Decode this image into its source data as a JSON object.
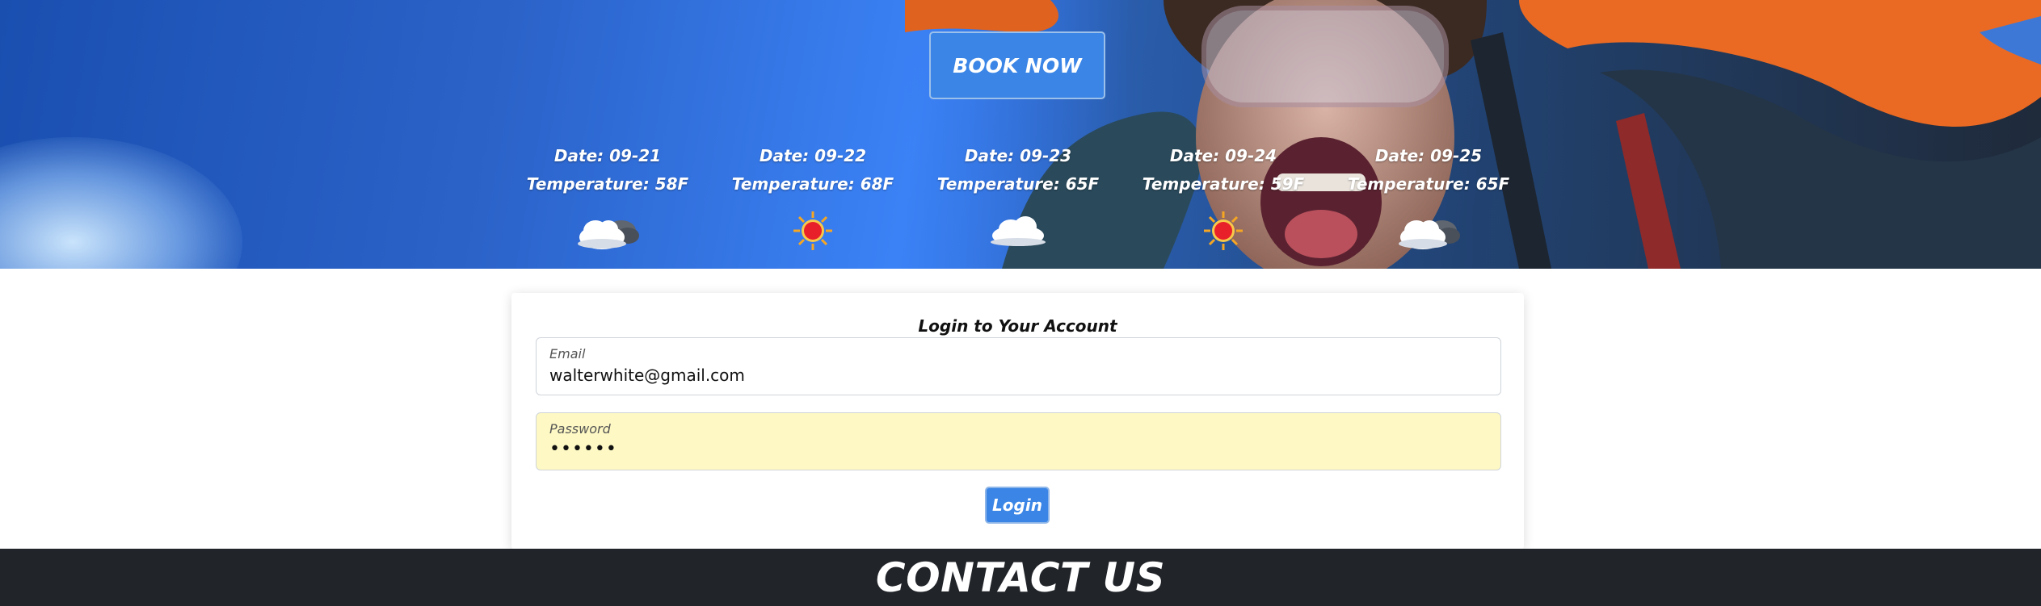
{
  "hero": {
    "book_now_label": "BOOK NOW",
    "forecast": [
      {
        "date": "Date: 09-21",
        "temperature": "Temperature: 58F",
        "icon": "partly-cloudy-icon"
      },
      {
        "date": "Date: 09-22",
        "temperature": "Temperature: 68F",
        "icon": "sun-icon"
      },
      {
        "date": "Date: 09-23",
        "temperature": "Temperature: 65F",
        "icon": "cloud-icon"
      },
      {
        "date": "Date: 09-24",
        "temperature": "Temperature: 59F",
        "icon": "sun-icon"
      },
      {
        "date": "Date: 09-25",
        "temperature": "Temperature: 65F",
        "icon": "partly-cloudy-icon"
      }
    ]
  },
  "login": {
    "title": "Login to Your Account",
    "email_label": "Email",
    "email_value": "walterwhite@gmail.com",
    "password_label": "Password",
    "password_value": "••••••",
    "button_label": "Login"
  },
  "footer": {
    "title": "CONTACT US"
  },
  "colors": {
    "primary_button": "#3a85e6",
    "footer_bg": "#212429",
    "password_autofill_bg": "#fef9c4"
  }
}
